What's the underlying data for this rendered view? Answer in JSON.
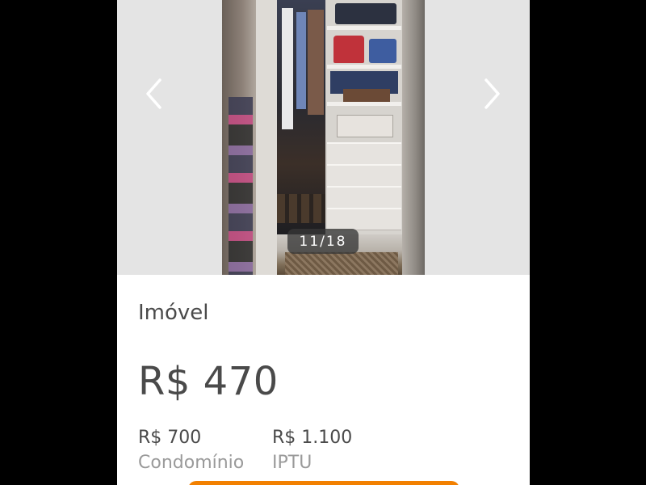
{
  "gallery": {
    "counter": "11/18",
    "prev_icon": "chevron-left-icon",
    "next_icon": "chevron-right-icon"
  },
  "listing": {
    "category": "Imóvel",
    "price": "R$ 470",
    "fees": [
      {
        "value": "R$ 700",
        "label": "Condomínio"
      },
      {
        "value": "R$ 1.100",
        "label": "IPTU"
      }
    ]
  },
  "colors": {
    "accent": "#f28000",
    "text_primary": "#4a4a4a",
    "text_secondary": "#9a9a9a",
    "gallery_bg": "#e4e4e4"
  }
}
